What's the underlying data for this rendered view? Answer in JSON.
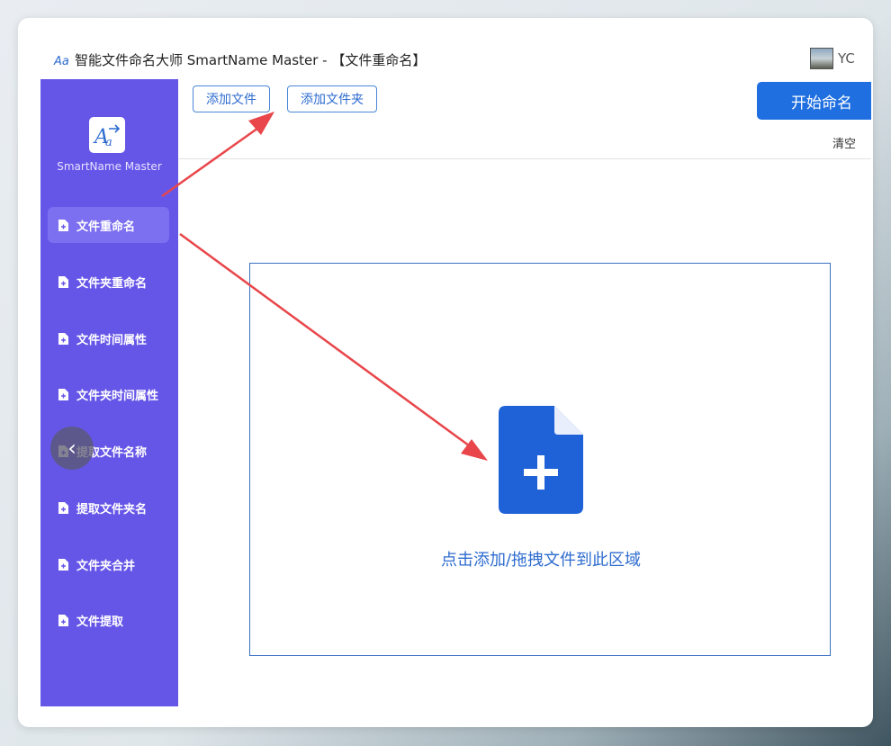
{
  "window": {
    "title": "智能文件命名大师 SmartName Master - 【文件重命名】",
    "username": "YC"
  },
  "sidebar": {
    "logo_name": "SmartName Master",
    "items": [
      {
        "label": "文件重命名",
        "active": true
      },
      {
        "label": "文件夹重命名"
      },
      {
        "label": "文件时间属性"
      },
      {
        "label": "文件夹时间属性"
      },
      {
        "label": "提取文件名称"
      },
      {
        "label": "提取文件夹名"
      },
      {
        "label": "文件夹合并"
      },
      {
        "label": "文件提取"
      }
    ]
  },
  "toolbar": {
    "add_file_label": "添加文件",
    "add_folder_label": "添加文件夹",
    "start_label": "开始命名",
    "clear_label": "清空"
  },
  "dropzone": {
    "text": "点击添加/拖拽文件到此区域"
  },
  "colors": {
    "sidebar_bg": "#6656e8",
    "accent": "#1f6fe0",
    "annotation_arrow": "#e8464a"
  }
}
